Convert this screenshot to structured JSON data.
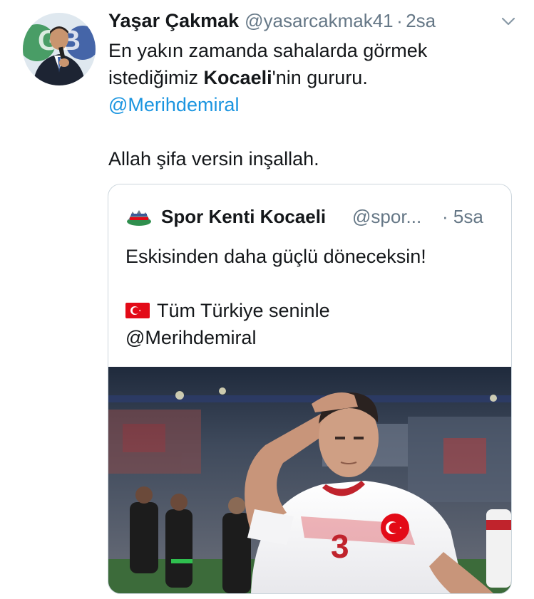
{
  "tweet": {
    "author_name": "Yaşar Çakmak",
    "author_handle": "@yasarcakmak41",
    "separator": "·",
    "time": "2sa",
    "text_line1": "En yakın zamanda sahalarda görmek",
    "text_line2_pre": "istediğimiz ",
    "text_line2_bold": "Kocaeli",
    "text_line2_post": "'nin gururu.",
    "mention": "@Merihdemiral",
    "text_line4": "Allah şifa versin inşallah.",
    "avatar_logo_text": "GB"
  },
  "quoted_tweet": {
    "author_name": "Spor Kenti Kocaeli",
    "author_handle": "@spor...",
    "time": "· 5sa",
    "text_line1": "Eskisinden daha güçlü döneceksin!",
    "text_line2": "Tüm Türkiye seninle",
    "mention": "@Merihdemiral",
    "jersey_number": "3"
  },
  "icons": {
    "menu": "chevron-down-icon",
    "flag": "turkey-flag-icon",
    "logo": "spor-kenti-logo-icon"
  },
  "colors": {
    "text": "#14171a",
    "secondary": "#657786",
    "link": "#1b95e0",
    "border": "#ccd6dd",
    "flag_red": "#e30a17"
  }
}
